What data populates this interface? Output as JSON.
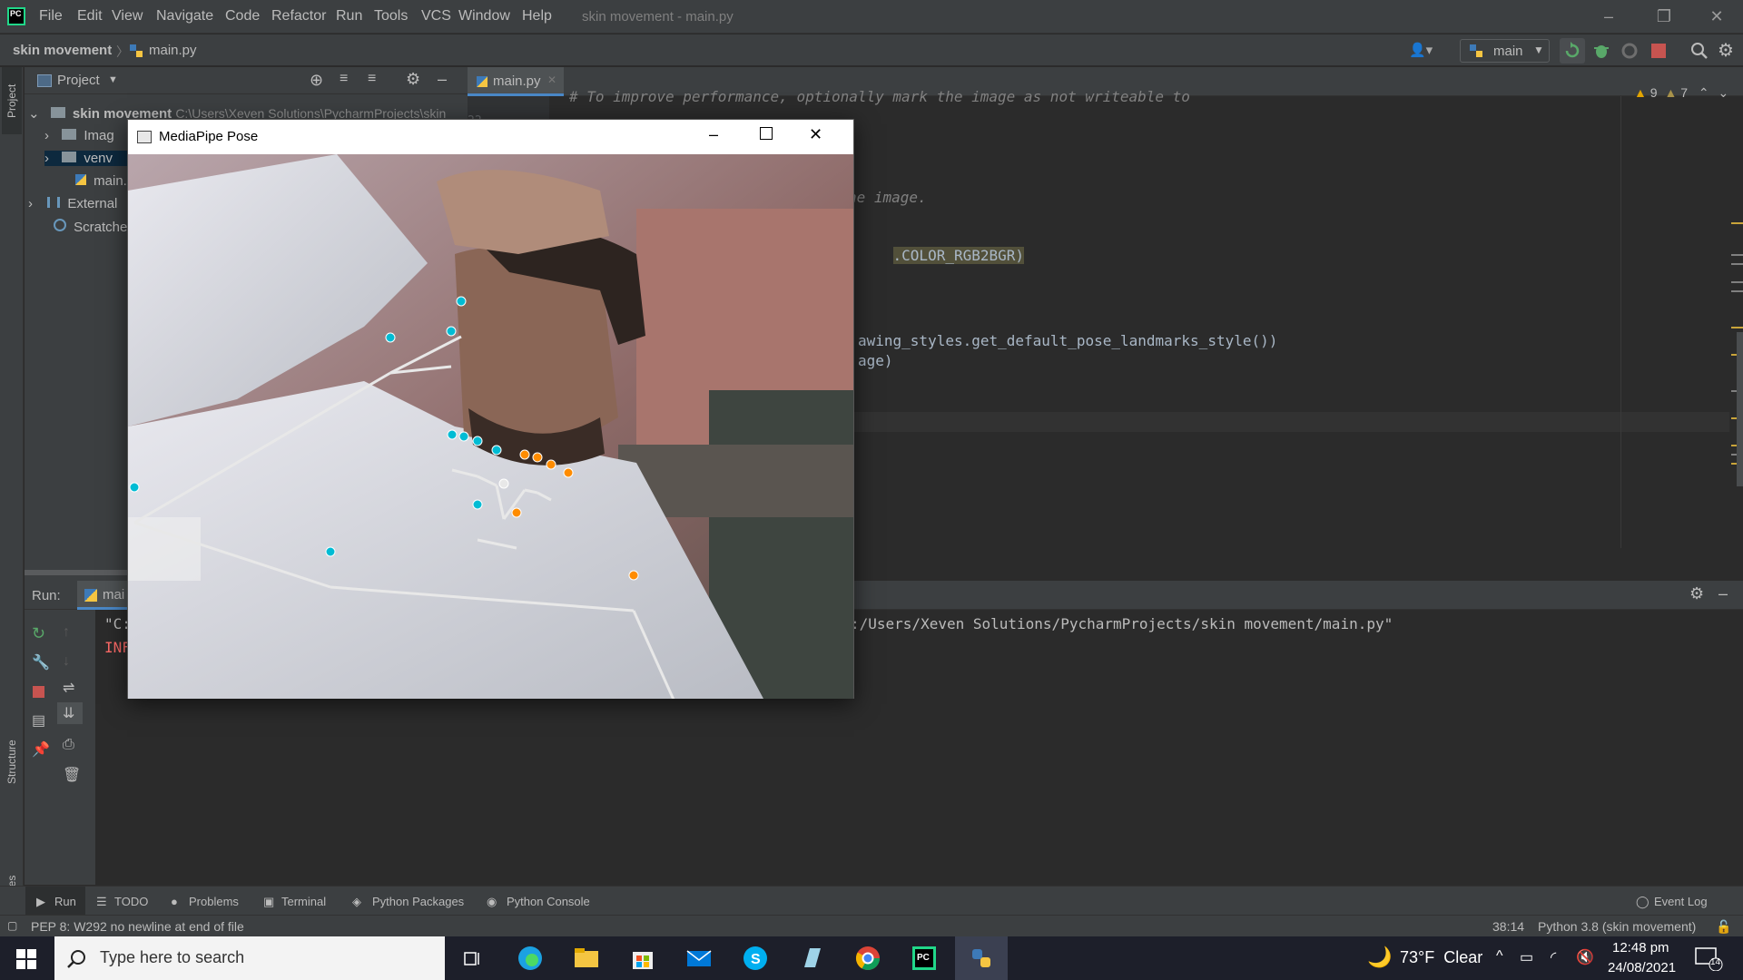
{
  "titlebar": {
    "menu": [
      "File",
      "Edit",
      "View",
      "Navigate",
      "Code",
      "Refactor",
      "Run",
      "Tools",
      "VCS",
      "Window",
      "Help"
    ],
    "title": "skin movement - main.py"
  },
  "navbar": {
    "project": "skin movement",
    "file": "main.py",
    "run_config": "main"
  },
  "left_strip": {
    "project": "Project",
    "structure": "Structure",
    "favorites": "Favorites"
  },
  "project_panel": {
    "title": "Project",
    "root": "skin movement",
    "root_path": "C:\\Users\\Xeven Solutions\\PycharmProjects\\skin",
    "items": [
      "Imag",
      "venv",
      "main.",
      "External",
      "Scratche"
    ]
  },
  "editor": {
    "tab": "main.py",
    "line_number": "22",
    "lines": [
      "# To improve performance, optionally mark the image as not writeable to",
      "he image.",
      ".COLOR_RGB2BGR)",
      "awing_styles.get_default_pose_landmarks_style())",
      "age)"
    ],
    "warnings": "9",
    "weak_warnings": "7"
  },
  "run_panel": {
    "label": "Run:",
    "tab": "mai",
    "line1_prefix": "\"C:",
    "line1_suffix": ":/Users/Xeven Solutions/PycharmProjects/skin movement/main.py\"",
    "line2_prefix": "INF"
  },
  "tool_tabs": [
    "Run",
    "TODO",
    "Problems",
    "Terminal",
    "Python Packages",
    "Python Console"
  ],
  "event_log": "Event Log",
  "status": {
    "message": "PEP 8: W292 no newline at end of file",
    "position": "38:14",
    "interpreter": "Python 3.8 (skin movement)"
  },
  "taskbar": {
    "search_placeholder": "Type here to search",
    "weather": "73°F  Clear",
    "time": "12:48 pm",
    "date": "24/08/2021",
    "notifications": "14"
  },
  "mediapipe_window": {
    "title": "MediaPipe Pose"
  },
  "colors": {
    "ide_bg": "#2b2b2b",
    "panel_bg": "#3c3f41",
    "landmark_left": "#00bcd4",
    "landmark_right": "#ff8c00",
    "connection": "#e8e8e8"
  }
}
